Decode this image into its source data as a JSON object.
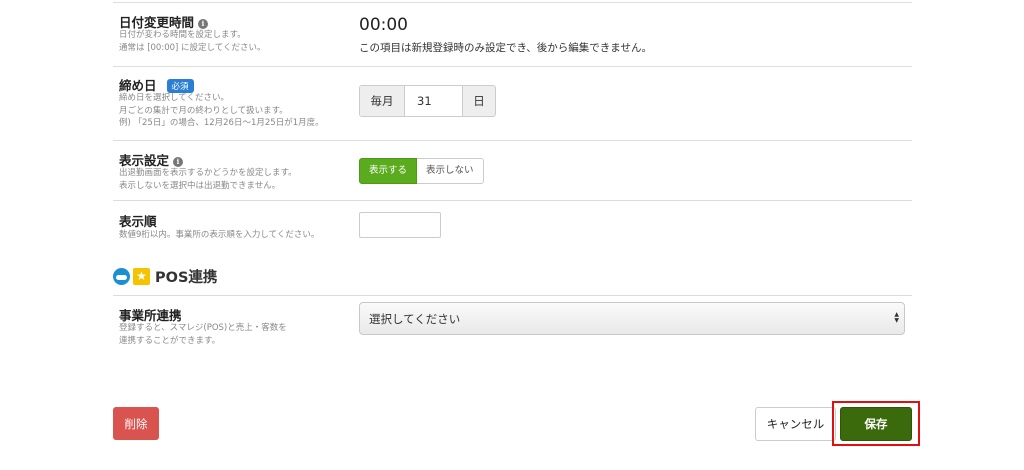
{
  "date_change": {
    "label": "日付変更時間",
    "help": [
      "日付が変わる時間を設定します。",
      "通常は [00:00] に設定してください。"
    ],
    "value": "00:00",
    "note": "この項目は新規登録時のみ設定でき、後から編集できません。"
  },
  "closing_day": {
    "label": "締め日",
    "required_badge": "必須",
    "help": [
      "締め日を選択してください。",
      "月ごとの集計で月の終わりとして扱います。",
      "例) 「25日」の場合、12月26日〜1月25日が1月度。"
    ],
    "prefix": "毎月",
    "value": "31",
    "suffix": "日"
  },
  "display_setting": {
    "label": "表示設定",
    "help": [
      "出退勤画面を表示するかどうかを設定します。",
      "表示しないを選択中は出退勤できません。"
    ],
    "option_show": "表示する",
    "option_hide": "表示しない",
    "selected": "表示する",
    "selected_color": "#5aac1e"
  },
  "display_order": {
    "label": "表示順",
    "help": [
      "数値9桁以内。事業所の表示順を入力してください。"
    ],
    "value": ""
  },
  "pos_section": {
    "title": "POS連携",
    "icons": [
      "cloud-icon",
      "star-icon"
    ],
    "office_link": {
      "label": "事業所連携",
      "help": [
        "登録すると、スマレジ(POS)と売上・客数を",
        "連携することができます。"
      ],
      "select_value": "選択してください"
    }
  },
  "actions": {
    "delete_label": "削除",
    "cancel_label": "キャンセル",
    "save_label": "保存",
    "delete_color": "#d9534f",
    "save_color": "#3b6a0c",
    "highlight_color": "#e01010"
  },
  "info_icon_glyph": "i"
}
